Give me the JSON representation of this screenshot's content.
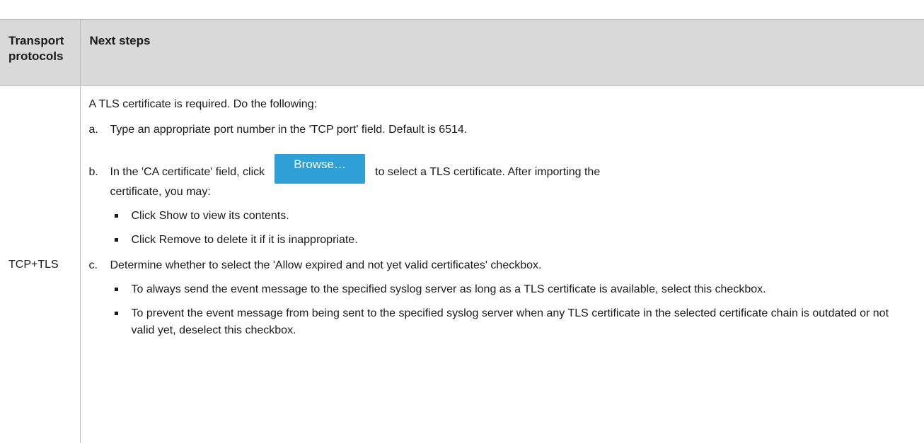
{
  "table": {
    "headers": [
      "Transport protocols",
      "Next steps"
    ],
    "protocol": "TCP+TLS",
    "intro": "A TLS certificate is required. Do the following:",
    "step_a": {
      "label": "a.",
      "text": "Type an appropriate port number in the 'TCP port' field. Default is 6514."
    },
    "step_b": {
      "label": "b.",
      "text_before": "In the 'CA certificate' field, click",
      "button_label": "Browse…",
      "text_after": "to select a TLS certificate. After importing the",
      "text_cont": "certificate, you may:",
      "bullets": [
        "Click Show to view its contents.",
        "Click Remove to delete it if it is inappropriate."
      ]
    },
    "step_c": {
      "label": "c.",
      "text": "Determine whether to select the 'Allow expired and not yet valid certificates' checkbox.",
      "bullets": [
        "To always send the event message to the specified syslog server as long as a TLS certificate is available, select this checkbox.",
        "To prevent the event message from being sent to the specified syslog server when any TLS certificate in the selected certificate chain is outdated or not valid yet, deselect this checkbox."
      ]
    }
  }
}
